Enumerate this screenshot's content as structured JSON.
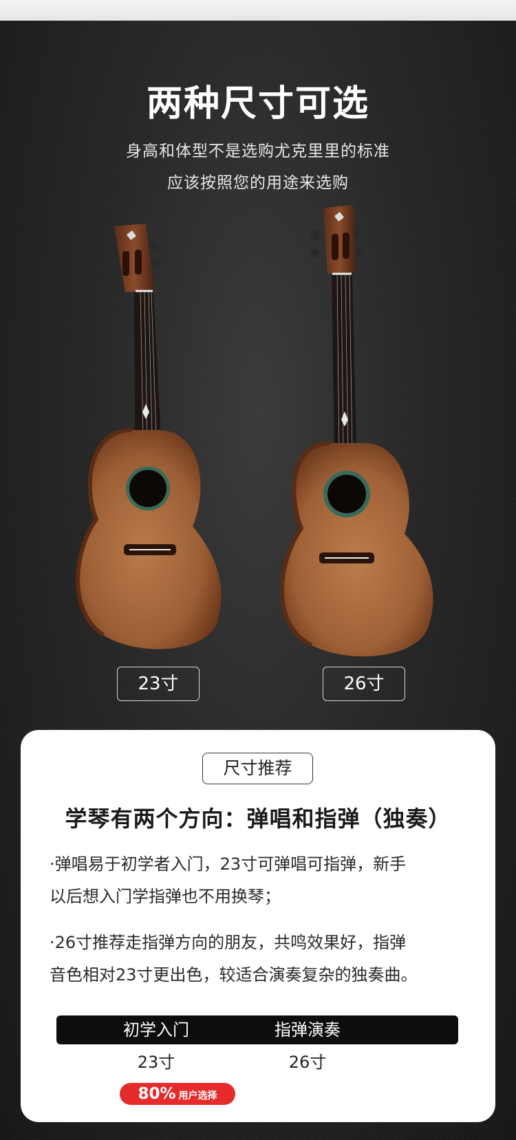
{
  "hero": {
    "title": "两种尺寸可选",
    "subtitle_line1": "身高和体型不是选购尤克里里的标准",
    "subtitle_line2": "应该按照您的用途来选购"
  },
  "sizes": {
    "small_label": "23寸",
    "large_label": "26寸"
  },
  "card": {
    "tag": "尺寸推荐",
    "heading": "学琴有两个方向：弹唱和指弹（独奏）",
    "paragraph1_line1": "·弹唱易于初学者入门，23寸可弹唱可指弹，新手",
    "paragraph1_line2": "以后想入门学指弹也不用换琴；",
    "paragraph2_line1": "·26寸推荐走指弹方向的朋友，共鸣效果好，指弹",
    "paragraph2_line2": "音色相对23寸更出色，较适合演奏复杂的独奏曲。",
    "choices": [
      {
        "label": "初学入门",
        "value": "23寸"
      },
      {
        "label": "指弹演奏",
        "value": "26寸"
      }
    ],
    "badge_percent": "80%",
    "badge_text": "用户选择"
  },
  "colors": {
    "background": "#1a1a1a",
    "card": "#ffffff",
    "badge": "#e62b2b",
    "wood": "#a0623a",
    "rosewood": "#3a1f14"
  },
  "icons": [
    "ukulele-23-image",
    "ukulele-26-image"
  ]
}
